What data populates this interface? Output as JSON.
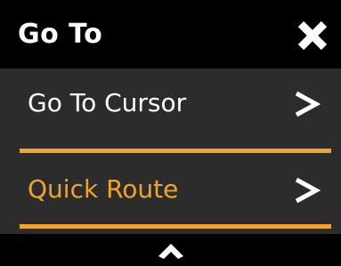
{
  "header": {
    "title": "Go To",
    "close_icon": "close-icon"
  },
  "items": [
    {
      "label": "Go To Cursor",
      "icon": "chevron-right-icon",
      "selected": false
    },
    {
      "label": "Quick Route",
      "icon": "chevron-right-icon",
      "selected": true
    }
  ],
  "footer": {
    "scroll_icon": "chevron-up-icon"
  },
  "colors": {
    "background": "#2c2c2c",
    "header_bg": "#000000",
    "accent": "#f0a52a",
    "text": "#ffffff"
  }
}
